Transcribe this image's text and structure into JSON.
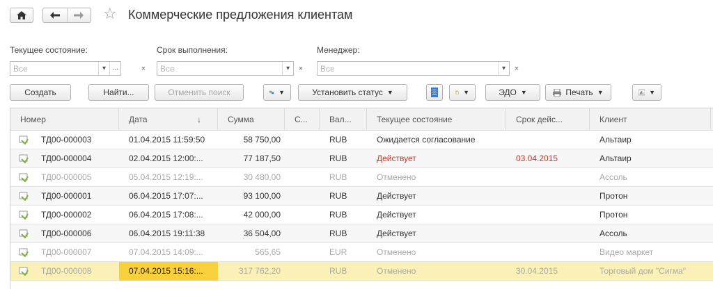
{
  "window": {
    "title": "Коммерческие предложения клиентам"
  },
  "nav": {
    "home_icon": "home-icon",
    "back_icon": "arrow-left-icon",
    "forward_icon": "arrow-right-icon",
    "favorite_icon": "star-icon"
  },
  "filters": {
    "state": {
      "label": "Текущее состояние:",
      "placeholder": "Все"
    },
    "term": {
      "label": "Срок выполнения:",
      "placeholder": "Все"
    },
    "manager": {
      "label": "Менеджер:",
      "placeholder": "Все"
    },
    "more_label": "...",
    "clear_label": "×",
    "dropdown_label": "▾"
  },
  "toolbar": {
    "create": "Создать",
    "find": "Найти...",
    "cancel_search": "Отменить поиск",
    "set_status": "Установить статус",
    "edo": "ЭДО",
    "print": "Печать"
  },
  "table": {
    "columns": [
      "Номер",
      "Дата",
      "Сумма",
      "С...",
      "Вал...",
      "Текущее состояние",
      "Срок дейс...",
      "Клиент"
    ],
    "sort_indicator": "↓",
    "rows": [
      {
        "number": "ТД00-000003",
        "date": "01.04.2015 11:59:50",
        "sum": "58 750,00",
        "s": "",
        "currency": "RUB",
        "state": "Ожидается согласование",
        "term": "",
        "client": "Альтаир",
        "status": "normal"
      },
      {
        "number": "ТД00-000004",
        "date": "02.04.2015 12:00:...",
        "sum": "77 187,50",
        "s": "",
        "currency": "RUB",
        "state": "Действует",
        "term": "03.04.2015",
        "client": "Альтаир",
        "status": "overdue"
      },
      {
        "number": "ТД00-000005",
        "date": "05.04.2015 12:19:...",
        "sum": "30 480,00",
        "s": "",
        "currency": "RUB",
        "state": "Отменено",
        "term": "",
        "client": "Ассоль",
        "status": "cancelled"
      },
      {
        "number": "ТД00-000001",
        "date": "06.04.2015 17:07:...",
        "sum": "93 100,00",
        "s": "",
        "currency": "RUB",
        "state": "Действует",
        "term": "",
        "client": "Протон",
        "status": "normal"
      },
      {
        "number": "ТД00-000002",
        "date": "06.04.2015 17:08:...",
        "sum": "42 000,00",
        "s": "",
        "currency": "RUB",
        "state": "Действует",
        "term": "",
        "client": "Протон",
        "status": "normal"
      },
      {
        "number": "ТД00-000006",
        "date": "06.04.2015 19:11:38",
        "sum": "36 504,00",
        "s": "",
        "currency": "RUB",
        "state": "Действует",
        "term": "",
        "client": "Ассоль",
        "status": "normal"
      },
      {
        "number": "ТД00-000007",
        "date": "07.04.2015 14:09:...",
        "sum": "565,65",
        "s": "",
        "currency": "EUR",
        "state": "Отменено",
        "term": "",
        "client": "Видео маркет",
        "status": "cancelled"
      },
      {
        "number": "ТД00-000008",
        "date": "07.04.2015 15:16:...",
        "sum": "317 762,20",
        "s": "",
        "currency": "RUB",
        "state": "Отменено",
        "term": "30.04.2015",
        "client": "Торговый дом \"Сигма\"",
        "status": "cancelled",
        "selected": true
      }
    ]
  },
  "colors": {
    "selected_row": "#fbf0b8",
    "selected_cell": "#f8d03b",
    "overdue_text": "#c0392b",
    "cancelled_text": "#a9a9a9",
    "doc_icon": "#7cb342"
  }
}
